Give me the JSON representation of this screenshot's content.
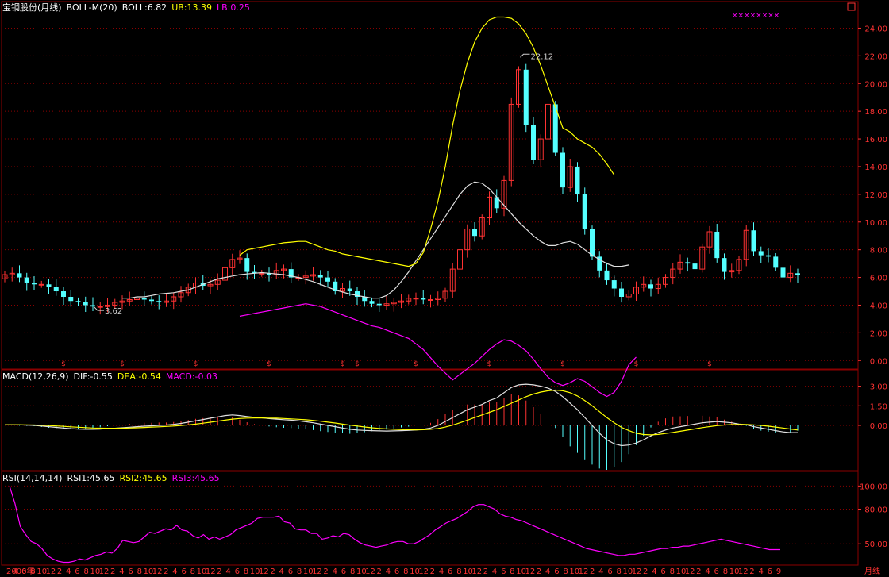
{
  "main_panel": {
    "header": [
      {
        "text": "宝钢股份(月线)",
        "color": "#ffffff"
      },
      {
        "text": "BOLL-M(20)",
        "color": "#ffffff"
      },
      {
        "text": "BOLL:6.82",
        "color": "#ffffff"
      },
      {
        "text": "UB:13.39",
        "color": "#ffff00"
      },
      {
        "text": "LB:0.25",
        "color": "#ff00ff"
      }
    ],
    "marker_stars": "××××××××",
    "high_label": "22.12",
    "low_label": "3.62",
    "dividend_mark": "$"
  },
  "macd_panel": {
    "header": [
      {
        "text": "MACD(12,26,9)",
        "color": "#ffffff"
      },
      {
        "text": "DIF:-0.55",
        "color": "#ffffff"
      },
      {
        "text": "DEA:-0.54",
        "color": "#ffff00"
      },
      {
        "text": "MACD:-0.03",
        "color": "#ff00ff"
      }
    ]
  },
  "rsi_panel": {
    "header": [
      {
        "text": "RSI(14,14,14)",
        "color": "#ffffff"
      },
      {
        "text": "RSI1:45.65",
        "color": "#ffffff"
      },
      {
        "text": "RSI2:45.65",
        "color": "#ffff00"
      },
      {
        "text": "RSI3:45.65",
        "color": "#ff00ff"
      }
    ]
  },
  "period_label": "月线",
  "colors": {
    "up": "#ff3232",
    "down": "#54ffff",
    "mid": "#e0e0e0",
    "ub": "#ffff00",
    "lb": "#ff00ff",
    "grid": "#8b0000",
    "axis_text": "#ff3232"
  },
  "chart_data": [
    {
      "type": "candlestick",
      "title": "宝钢股份(月线)",
      "ylim": [
        -0.5,
        25
      ],
      "yticks": [
        0,
        2,
        4,
        6,
        8,
        10,
        12,
        14,
        16,
        18,
        20,
        22,
        24
      ],
      "ytick_labels": [
        "0.00",
        "2.00",
        "4.00",
        "6.00",
        "8.00",
        "10.00",
        "12.00",
        "14.00",
        "16.00",
        "18.00",
        "20.00",
        "22.00",
        "24.00"
      ],
      "x_labels": [
        "2000年",
        "4",
        "6",
        "8",
        "10",
        "12",
        "2",
        "4",
        "6",
        "8",
        "10",
        "12",
        "2",
        "4",
        "6",
        "8",
        "10",
        "12",
        "2",
        "4",
        "6",
        "8",
        "10",
        "12",
        "2",
        "4",
        "6",
        "8",
        "10",
        "12",
        "2",
        "4",
        "6",
        "8",
        "10",
        "12",
        "2",
        "4",
        "6",
        "8",
        "10",
        "12",
        "2",
        "4",
        "6",
        "8",
        "10",
        "12",
        "2",
        "4",
        "6",
        "8",
        "10",
        "12",
        "2",
        "4",
        "6",
        "8",
        "10",
        "12",
        "2",
        "4",
        "6",
        "8",
        "10",
        "12",
        "2",
        "4",
        "6",
        "8",
        "10",
        "12",
        "2",
        "4",
        "6",
        "8",
        "10",
        "12",
        "2",
        "4",
        "6",
        "8",
        "10",
        "12",
        "2",
        "4",
        "6",
        "9"
      ],
      "dividend_bars": [
        8,
        16,
        26,
        36,
        46,
        48,
        56,
        66,
        76,
        86,
        96
      ],
      "close": [
        6.2,
        6.3,
        6.0,
        5.6,
        5.5,
        5.5,
        5.3,
        5.0,
        4.6,
        4.3,
        4.2,
        4.0,
        3.9,
        3.9,
        4.0,
        4.2,
        4.3,
        4.4,
        4.5,
        4.4,
        4.3,
        4.2,
        4.3,
        4.6,
        4.9,
        5.3,
        5.6,
        5.4,
        5.5,
        5.8,
        6.7,
        7.3,
        7.4,
        6.4,
        6.3,
        6.3,
        6.2,
        6.5,
        6.6,
        6.0,
        6.0,
        6.1,
        6.2,
        6.0,
        5.7,
        5.0,
        5.2,
        5.0,
        4.6,
        4.3,
        4.1,
        4.0,
        4.1,
        4.2,
        4.3,
        4.5,
        4.5,
        4.4,
        4.4,
        4.5,
        5.0,
        6.6,
        8.0,
        9.5,
        9.0,
        10.3,
        11.8,
        11.0,
        13.0,
        18.5,
        21.0,
        17.0,
        14.5,
        16.0,
        18.5,
        15.0,
        12.5,
        14.0,
        12.0,
        9.5,
        7.5,
        6.5,
        5.8,
        5.2,
        4.6,
        4.8,
        5.3,
        5.5,
        5.2,
        5.5,
        6.0,
        6.6,
        7.1,
        7.0,
        6.6,
        8.2,
        9.3,
        7.4,
        6.4,
        6.5,
        7.3,
        9.4,
        7.9,
        7.6,
        7.5,
        6.7,
        6.0,
        6.3,
        6.2
      ],
      "bollinger": {
        "mid_start": 16,
        "mid": [
          4.5,
          4.5,
          4.6,
          4.6,
          4.7,
          4.8,
          4.85,
          4.9,
          5.0,
          5.1,
          5.3,
          5.5,
          5.7,
          5.9,
          6.0,
          6.1,
          6.2,
          6.25,
          6.3,
          6.35,
          6.3,
          6.25,
          6.2,
          6.1,
          6.0,
          5.85,
          5.7,
          5.5,
          5.3,
          5.1,
          4.95,
          4.8,
          4.7,
          4.6,
          4.5,
          4.5,
          4.7,
          5.1,
          5.7,
          6.4,
          7.2,
          8.0,
          8.8,
          9.6,
          10.4,
          11.2,
          12.0,
          12.6,
          12.9,
          12.8,
          12.4,
          11.8,
          11.2,
          10.6,
          10.0,
          9.5,
          9.0,
          8.6,
          8.3,
          8.3,
          8.5,
          8.6,
          8.4,
          8.0,
          7.6,
          7.3,
          7.0,
          6.8,
          6.8,
          6.9
        ],
        "ub_start": 32,
        "ub": [
          7.6,
          8.0,
          8.1,
          8.2,
          8.3,
          8.4,
          8.5,
          8.55,
          8.6,
          8.6,
          8.4,
          8.2,
          8.0,
          7.9,
          7.7,
          7.6,
          7.5,
          7.4,
          7.3,
          7.2,
          7.1,
          7.0,
          6.9,
          6.8,
          7.0,
          7.8,
          9.5,
          11.5,
          14.0,
          17.0,
          19.5,
          21.5,
          23.0,
          24.0,
          24.6,
          24.8,
          24.8,
          24.7,
          24.3,
          23.6,
          22.6,
          21.3,
          19.8,
          18.3,
          16.8,
          16.5,
          16.0,
          15.7,
          15.4,
          14.9,
          14.2,
          13.4
        ],
        "lb_start": 32,
        "lb": [
          3.2,
          3.3,
          3.4,
          3.5,
          3.6,
          3.7,
          3.8,
          3.9,
          4.0,
          4.1,
          4.0,
          3.9,
          3.7,
          3.5,
          3.3,
          3.1,
          2.9,
          2.7,
          2.5,
          2.4,
          2.2,
          2.0,
          1.8,
          1.6,
          1.2,
          0.8,
          0.2,
          -0.4,
          -0.9,
          -1.4,
          -1.0,
          -0.6,
          -0.2,
          0.3,
          0.8,
          1.2,
          1.5,
          1.4,
          1.1,
          0.7,
          0.1,
          -0.6,
          -1.2,
          -1.6,
          -1.8,
          -1.6,
          -1.3,
          -1.5,
          -1.9,
          -2.3,
          -2.6,
          -2.3,
          -1.5,
          -0.3,
          0.25
        ]
      }
    },
    {
      "type": "bar",
      "title": "MACD(12,26,9)",
      "ylim": [
        -3.4,
        3.4
      ],
      "yticks": [
        0,
        1.5,
        3
      ],
      "ytick_labels": [
        "0.00",
        "1.50",
        "3.00"
      ],
      "dif": [
        0.05,
        0.05,
        0.04,
        0.02,
        0.0,
        -0.05,
        -0.1,
        -0.15,
        -0.2,
        -0.25,
        -0.28,
        -0.3,
        -0.3,
        -0.28,
        -0.25,
        -0.22,
        -0.18,
        -0.14,
        -0.1,
        -0.06,
        -0.03,
        0.0,
        0.03,
        0.08,
        0.15,
        0.25,
        0.35,
        0.45,
        0.55,
        0.65,
        0.75,
        0.8,
        0.75,
        0.68,
        0.62,
        0.58,
        0.52,
        0.48,
        0.44,
        0.4,
        0.35,
        0.28,
        0.2,
        0.1,
        0.0,
        -0.1,
        -0.2,
        -0.3,
        -0.35,
        -0.38,
        -0.4,
        -0.42,
        -0.43,
        -0.42,
        -0.4,
        -0.38,
        -0.35,
        -0.3,
        -0.2,
        0.0,
        0.3,
        0.6,
        0.9,
        1.2,
        1.4,
        1.6,
        1.9,
        2.1,
        2.5,
        2.9,
        3.1,
        3.15,
        3.1,
        3.0,
        2.85,
        2.6,
        2.2,
        1.7,
        1.2,
        0.6,
        0.0,
        -0.6,
        -1.1,
        -1.4,
        -1.55,
        -1.5,
        -1.35,
        -1.1,
        -0.8,
        -0.55,
        -0.35,
        -0.2,
        -0.1,
        0.0,
        0.1,
        0.2,
        0.25,
        0.3,
        0.25,
        0.2,
        0.1,
        0.05,
        -0.1,
        -0.2,
        -0.3,
        -0.4,
        -0.5,
        -0.55,
        -0.55
      ],
      "dea": [
        0.05,
        0.05,
        0.05,
        0.04,
        0.03,
        0.01,
        -0.01,
        -0.04,
        -0.07,
        -0.11,
        -0.14,
        -0.17,
        -0.2,
        -0.21,
        -0.22,
        -0.22,
        -0.21,
        -0.2,
        -0.18,
        -0.16,
        -0.13,
        -0.11,
        -0.08,
        -0.05,
        -0.01,
        0.04,
        0.1,
        0.17,
        0.24,
        0.32,
        0.4,
        0.48,
        0.53,
        0.56,
        0.57,
        0.57,
        0.56,
        0.55,
        0.53,
        0.5,
        0.47,
        0.43,
        0.38,
        0.32,
        0.25,
        0.18,
        0.1,
        0.02,
        -0.05,
        -0.12,
        -0.18,
        -0.23,
        -0.27,
        -0.3,
        -0.32,
        -0.33,
        -0.34,
        -0.33,
        -0.3,
        -0.24,
        -0.13,
        0.02,
        0.2,
        0.4,
        0.6,
        0.8,
        1.0,
        1.2,
        1.45,
        1.7,
        1.95,
        2.2,
        2.4,
        2.55,
        2.65,
        2.7,
        2.65,
        2.5,
        2.25,
        1.9,
        1.5,
        1.05,
        0.6,
        0.2,
        -0.15,
        -0.4,
        -0.6,
        -0.7,
        -0.72,
        -0.69,
        -0.62,
        -0.54,
        -0.45,
        -0.36,
        -0.27,
        -0.17,
        -0.09,
        -0.02,
        0.03,
        0.06,
        0.07,
        0.07,
        0.04,
        0.0,
        -0.06,
        -0.13,
        -0.2,
        -0.28,
        -0.35
      ]
    },
    {
      "type": "line",
      "title": "RSI(14,14,14)",
      "ylim": [
        33,
        103
      ],
      "yticks": [
        50,
        80,
        100
      ],
      "ytick_labels": [
        "50.00",
        "80.00",
        "100.00"
      ],
      "values": [
        100,
        85,
        65,
        58,
        52,
        50,
        46,
        40,
        37,
        35,
        34,
        34,
        35,
        37,
        36,
        38,
        40,
        41,
        43,
        42,
        46,
        53,
        52,
        51,
        52,
        56,
        60,
        59,
        61,
        63,
        62,
        66,
        62,
        61,
        57,
        55,
        58,
        54,
        56,
        54,
        56,
        58,
        62,
        64,
        66,
        68,
        72,
        73,
        73,
        73,
        74,
        69,
        68,
        63,
        62,
        62,
        59,
        59,
        54,
        55,
        57,
        56,
        59,
        58,
        54,
        51,
        49,
        48,
        47,
        48,
        49,
        51,
        52,
        52,
        50,
        50,
        52,
        55,
        58,
        62,
        65,
        68,
        70,
        72,
        75,
        78,
        82,
        84,
        84,
        82,
        80,
        76,
        74,
        73,
        71,
        70,
        68,
        66,
        64,
        62,
        60,
        58,
        56,
        54,
        52,
        50,
        48,
        46,
        45,
        44,
        43,
        42,
        41,
        40,
        40,
        41,
        41,
        42,
        43,
        44,
        45,
        46,
        46,
        47,
        47,
        48,
        48,
        49,
        50,
        51,
        52,
        53,
        54,
        53,
        52,
        51,
        50,
        49,
        48,
        47,
        46,
        45,
        45,
        45
      ]
    }
  ]
}
